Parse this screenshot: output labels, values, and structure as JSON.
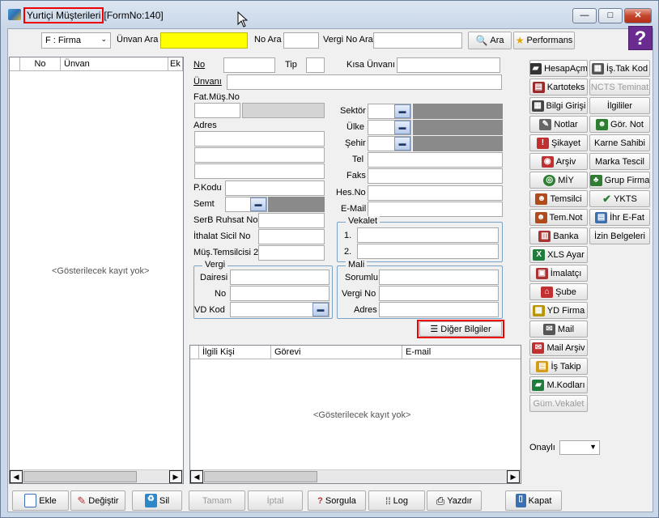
{
  "window": {
    "title": "Yurtiçi Müşterileri",
    "form_no": "[FormNo:140]",
    "min": "—",
    "max": "□",
    "close": "✕"
  },
  "toolbar": {
    "type_select": "F : Firma",
    "unvan_ara_label": "Ünvan Ara",
    "no_ara_label": "No Ara",
    "vergi_no_ara_label": "Vergi No Ara",
    "ara_button": "Ara",
    "performans_button": "Performans",
    "help": "?"
  },
  "left_grid": {
    "columns": [
      "No",
      "Ünvan",
      "Ek"
    ],
    "empty_text": "<Gösterilecek kayıt yok>"
  },
  "form": {
    "no": "No",
    "tip": "Tip",
    "kisa_unvan": "Kısa Ünvanı",
    "unvan": "Ünvanı",
    "fat_mus_no": "Fat.Müş.No",
    "adres": "Adres",
    "pkodu": "P.Kodu",
    "semt": "Semt",
    "serb_ruhsat": "SerB Ruhsat No",
    "ithalat_sicil": "İthalat Sicil No",
    "mus_temsilcisi": "Müş.Temsilcisi 2",
    "sektor": "Sektör",
    "ulke": "Ülke",
    "sehir": "Şehir",
    "tel": "Tel",
    "faks": "Faks",
    "hes_no": "Hes.No",
    "email": "E-Mail",
    "vekalet_title": "Vekalet",
    "vekalet_1": "1.",
    "vekalet_2": "2.",
    "vergi_title": "Vergi",
    "vergi_dairesi": "Dairesi",
    "vergi_no": "No",
    "vd_kod": "VD Kod",
    "mali_title": "Mali",
    "mali_sorumlu": "Sorumlu",
    "mali_vergi_no": "Vergi No",
    "mali_adres": "Adres",
    "diger_bilgiler": "Diğer Bilgiler"
  },
  "contact_grid": {
    "columns": [
      "İlgili Kişi",
      "Görevi",
      "E-mail"
    ],
    "empty_text": "<Gösterilecek kayıt yok>"
  },
  "side_buttons_col1": [
    "HesapAçm",
    "Kartoteks",
    "Bilgi Girişi",
    "Notlar",
    "Şikayet",
    "Arşiv",
    "MİY",
    "Temsilci",
    "Tem.Not",
    "Banka",
    "XLS Ayar",
    "İmalatçı",
    "Şube",
    "YD Firma",
    "Mail",
    "Mail Arşiv",
    "İş Takip",
    "M.Kodları",
    "Güm.Vekalet"
  ],
  "side_buttons_col2": [
    "İş.Tak Kod",
    "NCTS Teminat",
    "İlgililer",
    "Gör. Not",
    "Karne Sahibi",
    "Marka Tescil",
    "Grup Firma",
    "YKTS",
    "İhr E-Fat",
    "İzin Belgeleri"
  ],
  "onayli_label": "Onaylı",
  "bottom": {
    "ekle": "Ekle",
    "degistir": "Değiştir",
    "sil": "Sil",
    "tamam": "Tamam",
    "iptal": "İptal",
    "sorgula": "Sorgula",
    "log": "Log",
    "yazdir": "Yazdır",
    "kapat": "Kapat"
  },
  "colors": {
    "accent_yellow": "#ffff00",
    "highlight_red": "#e00000",
    "help_purple": "#6a2c91"
  }
}
